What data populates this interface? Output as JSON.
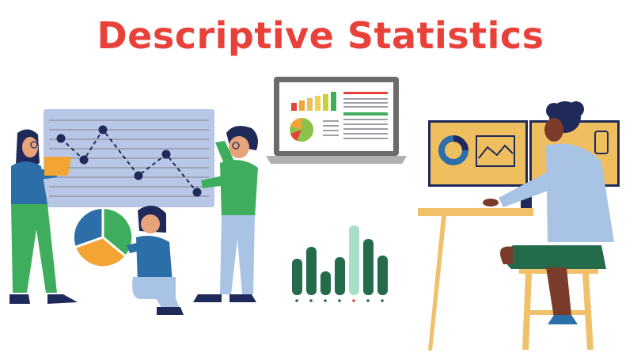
{
  "header": {
    "title": "Descriptive Statistics",
    "title_color": "#e8413a"
  },
  "palette": {
    "board": "#b8c7e6",
    "board_line": "#8c8fa0",
    "navy": "#1f2a5a",
    "blue": "#2b6ea8",
    "green": "#3fae5c",
    "light_blue": "#a8c3e3",
    "orange": "#f3a533",
    "gold": "#efbf5f",
    "dark_green": "#236b4a",
    "mint": "#a8dfc8",
    "skin": "#7a3b2a",
    "desk": "#f0c06a"
  },
  "illustrations": [
    {
      "name": "presentation-board-line-chart"
    },
    {
      "name": "woman-holding-orange-folder"
    },
    {
      "name": "man-pointing-at-board"
    },
    {
      "name": "kneeling-person-with-pie-chart"
    },
    {
      "name": "laptop-with-dashboard"
    },
    {
      "name": "green-bar-chart"
    },
    {
      "name": "person-at-desk-with-monitors"
    }
  ]
}
